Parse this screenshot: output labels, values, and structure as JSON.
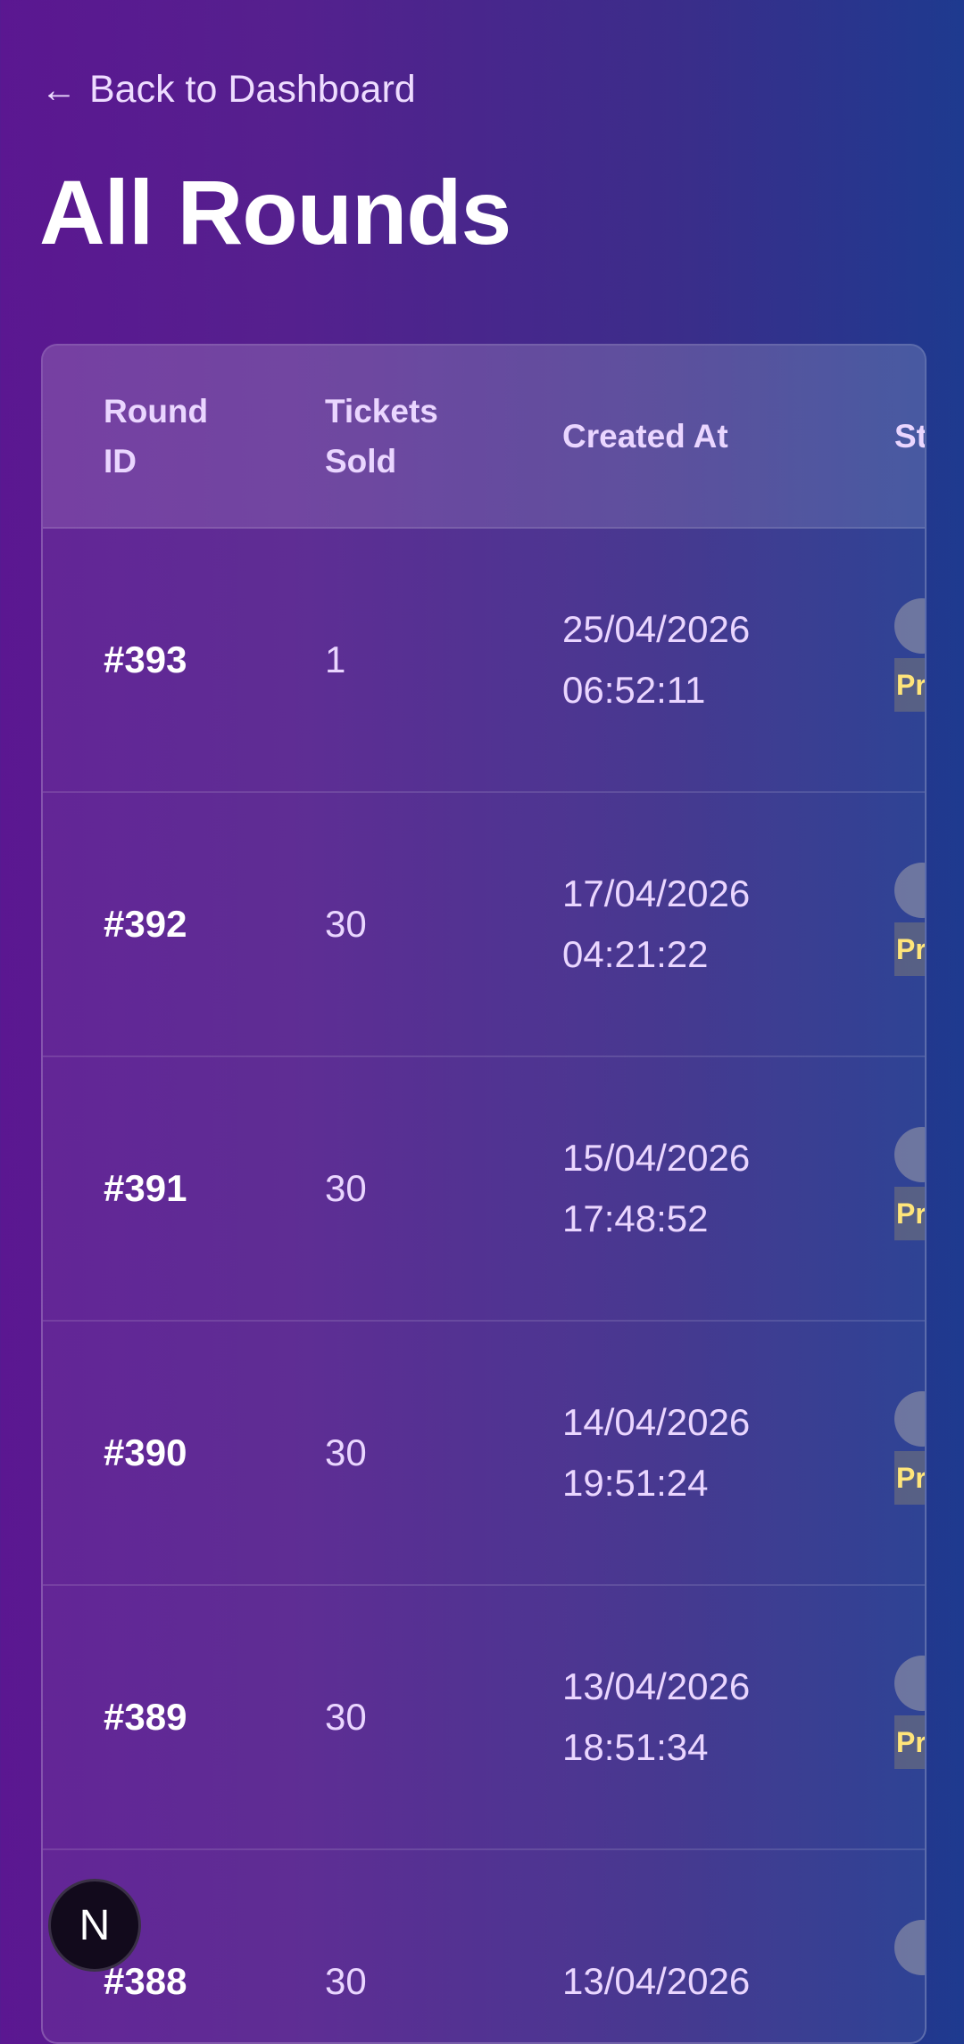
{
  "nav": {
    "back_label": "Back to Dashboard",
    "back_icon": "←"
  },
  "page": {
    "title": "All Rounds"
  },
  "table": {
    "headers": {
      "round_id": "Round ID",
      "tickets_sold": "Tickets Sold",
      "created_at": "Created At",
      "status": "St"
    },
    "rows": [
      {
        "id": "#393",
        "tickets": "1",
        "created_date": "25/04/2026",
        "created_time": "06:52:11",
        "status": "Pr"
      },
      {
        "id": "#392",
        "tickets": "30",
        "created_date": "17/04/2026",
        "created_time": "04:21:22",
        "status": "Pr"
      },
      {
        "id": "#391",
        "tickets": "30",
        "created_date": "15/04/2026",
        "created_time": "17:48:52",
        "status": "Pr"
      },
      {
        "id": "#390",
        "tickets": "30",
        "created_date": "14/04/2026",
        "created_time": "19:51:24",
        "status": "Pr"
      },
      {
        "id": "#389",
        "tickets": "30",
        "created_date": "13/04/2026",
        "created_time": "18:51:34",
        "status": "Pr"
      },
      {
        "id": "#388",
        "tickets": "30",
        "created_date": "13/04/2026",
        "created_time": "",
        "status": ""
      }
    ]
  },
  "fab": {
    "label": "N"
  },
  "colors": {
    "bg_left": "#5b1791",
    "bg_right": "#1e3a8f",
    "status_text": "#ffe57a",
    "header_text": "#ead6ff"
  }
}
